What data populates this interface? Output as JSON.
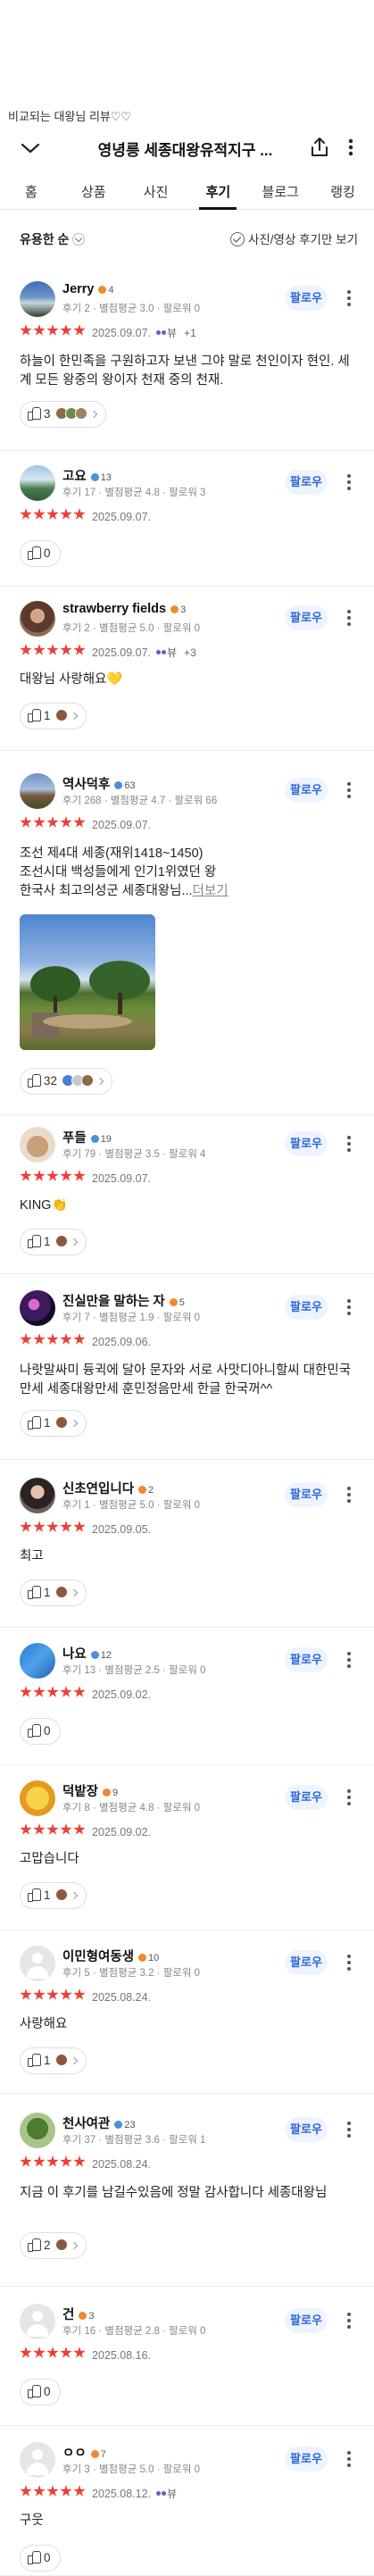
{
  "top_note": "비교되는 대왕님 리뷰♡♡",
  "header": {
    "title": "영녕릉 세종대왕유적지구 ..."
  },
  "tabs": [
    {
      "label": "홈",
      "active": false
    },
    {
      "label": "상품",
      "active": false
    },
    {
      "label": "사진",
      "active": false
    },
    {
      "label": "후기",
      "active": true
    },
    {
      "label": "블로그",
      "active": false
    },
    {
      "label": "랭킹",
      "active": false
    }
  ],
  "sort_label": "유용한 순",
  "photo_filter_label": "사진/영상 후기만 보기",
  "follow_label": "팔로우",
  "more_label": "더보기",
  "colors": {
    "star": "#ef3e36",
    "follow_text": "#2a66d9",
    "follow_bg": "#eef4ff"
  },
  "reviews": [
    {
      "name": "Jerry",
      "level": "4",
      "meta": "후기 2 · 별점평균 3.0 · 팔로워 0",
      "rating": 5,
      "date": "2025.09.07.",
      "mini": "뷰",
      "plus": "+1",
      "text": "하늘이 한민족을 구원하고자 보낸 그야 말로 천인이자 현인. 세계 모든 왕중의 왕이자 천재 중의 천재.",
      "reactions": "3",
      "avatar": "photo-sky"
    },
    {
      "name": "고요",
      "level": "13",
      "meta": "후기 17 · 별점평균 4.8 · 팔로워 3",
      "rating": 5,
      "date": "2025.09.07.",
      "text": "",
      "reactions": "0",
      "avatar": "photo-sea"
    },
    {
      "name": "strawberry fields",
      "level": "3",
      "meta": "후기 2 · 별점평균 5.0 · 팔로워 0",
      "rating": 5,
      "date": "2025.09.07.",
      "mini": "뷰",
      "plus": "+3",
      "text": "대왕님 사랑해요💛",
      "reactions": "1",
      "avatar": "photo-person"
    },
    {
      "name": "역사덕후",
      "level": "63",
      "meta": "후기 268 · 별점평균 4.7 · 팔로워 66",
      "rating": 5,
      "date": "2025.09.07.",
      "text": "조선 제4대 세종(재위1418~1450) 조선시대 백성들에게 인기1위였던 왕 한국사 최고의성군 세종대왕님...",
      "text_lines": [
        "조선 제4대 세종(재위1418~1450)",
        "조선시대 백성들에게 인기1위였던 왕",
        "한국사 최고의성군 세종대왕님..."
      ],
      "reactions": "32",
      "avatar": "photo-palace"
    },
    {
      "name": "푸들",
      "level": "19",
      "meta": "후기 79 · 별점평균 3.5 · 팔로워 4",
      "rating": 5,
      "date": "2025.09.07.",
      "text": "KING👏",
      "reactions": "1",
      "avatar": "photo-dog"
    },
    {
      "name": "진실만을 말하는 자",
      "level": "5",
      "meta": "후기 7 · 별점평균 1.9 · 팔로워 0",
      "rating": 5,
      "date": "2025.09.06.",
      "text": "나랏말싸미 듕귁에 달아 문자와 서로 사맛디아니할씨 대한민국만세 세종대왕만세 훈민정음만세 한글 한국꺼^^",
      "reactions": "1",
      "avatar": "photo-night"
    },
    {
      "name": "신초연입니다",
      "level": "2",
      "meta": "후기 1 · 별점평균 5.0 · 팔로워 0",
      "rating": 5,
      "date": "2025.09.05.",
      "text": "최고",
      "reactions": "1",
      "avatar": "photo-portrait"
    },
    {
      "name": "나요",
      "level": "12",
      "meta": "후기 13 · 별점평균 2.5 · 팔로워 0",
      "rating": 5,
      "date": "2025.09.02.",
      "text": "",
      "reactions": "0",
      "avatar": "photo-blue"
    },
    {
      "name": "덕밭장",
      "level": "9",
      "meta": "후기 8 · 별점평균 4.8 · 팔로워 0",
      "rating": 5,
      "date": "2025.09.02.",
      "text": "고맙습니다",
      "reactions": "1",
      "avatar": "photo-yellow"
    },
    {
      "name": "이민형여동생",
      "level": "10",
      "meta": "후기 5 · 별점평균 3.2 · 팔로워 0",
      "rating": 5,
      "date": "2025.08.24.",
      "text": "사랑해요",
      "reactions": "1",
      "avatar": "default"
    },
    {
      "name": "천사여관",
      "level": "23",
      "meta": "후기 37 · 별점평균 3.6 · 팔로워 1",
      "rating": 5,
      "date": "2025.08.24.",
      "text": "지금 이 후기를 남길수있음에 정말 감사합니다 세종대왕님",
      "reactions": "2",
      "avatar": "photo-tree"
    },
    {
      "name": "건",
      "level": "3",
      "meta": "후기 16 · 별점평균 2.8 · 팔로워 0",
      "rating": 5,
      "date": "2025.08.16.",
      "text": "",
      "reactions": "0",
      "avatar": "default"
    },
    {
      "name": "ㅇㅇ",
      "level": "7",
      "meta": "후기 3 · 별점평균 5.0 · 팔로워 0",
      "rating": 5,
      "date": "2025.08.12.",
      "mini": "뷰",
      "text": "구웃",
      "reactions": "0",
      "avatar": "default"
    }
  ]
}
